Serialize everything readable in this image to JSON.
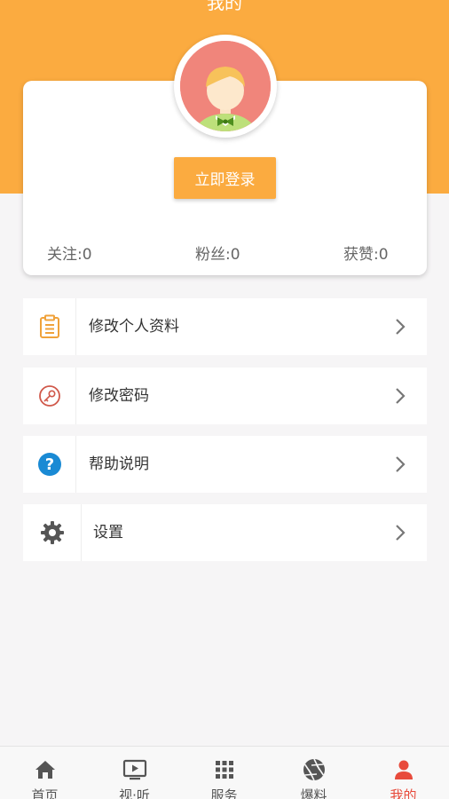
{
  "header": {
    "title": "我的"
  },
  "profile": {
    "login_label": "立即登录",
    "stats": [
      {
        "label": "关注:",
        "value": "0"
      },
      {
        "label": "粉丝:",
        "value": "0"
      },
      {
        "label": "获赞:",
        "value": "0"
      }
    ]
  },
  "menu": [
    {
      "label": "修改个人资料",
      "icon": "clipboard-icon"
    },
    {
      "label": "修改密码",
      "icon": "key-icon"
    },
    {
      "label": "帮助说明",
      "icon": "help-icon"
    },
    {
      "label": "设置",
      "icon": "gear-icon"
    }
  ],
  "tabbar": {
    "tabs": [
      {
        "label": "首页",
        "icon": "home-icon"
      },
      {
        "label": "视·听",
        "icon": "tv-play-icon"
      },
      {
        "label": "服务",
        "icon": "grid-icon"
      },
      {
        "label": "爆料",
        "icon": "aperture-icon"
      },
      {
        "label": "我的",
        "icon": "person-icon",
        "active": true
      }
    ]
  },
  "colors": {
    "accent": "#fbab40",
    "tab_active": "#e84b3c",
    "help_blue": "#1a8ad4"
  }
}
